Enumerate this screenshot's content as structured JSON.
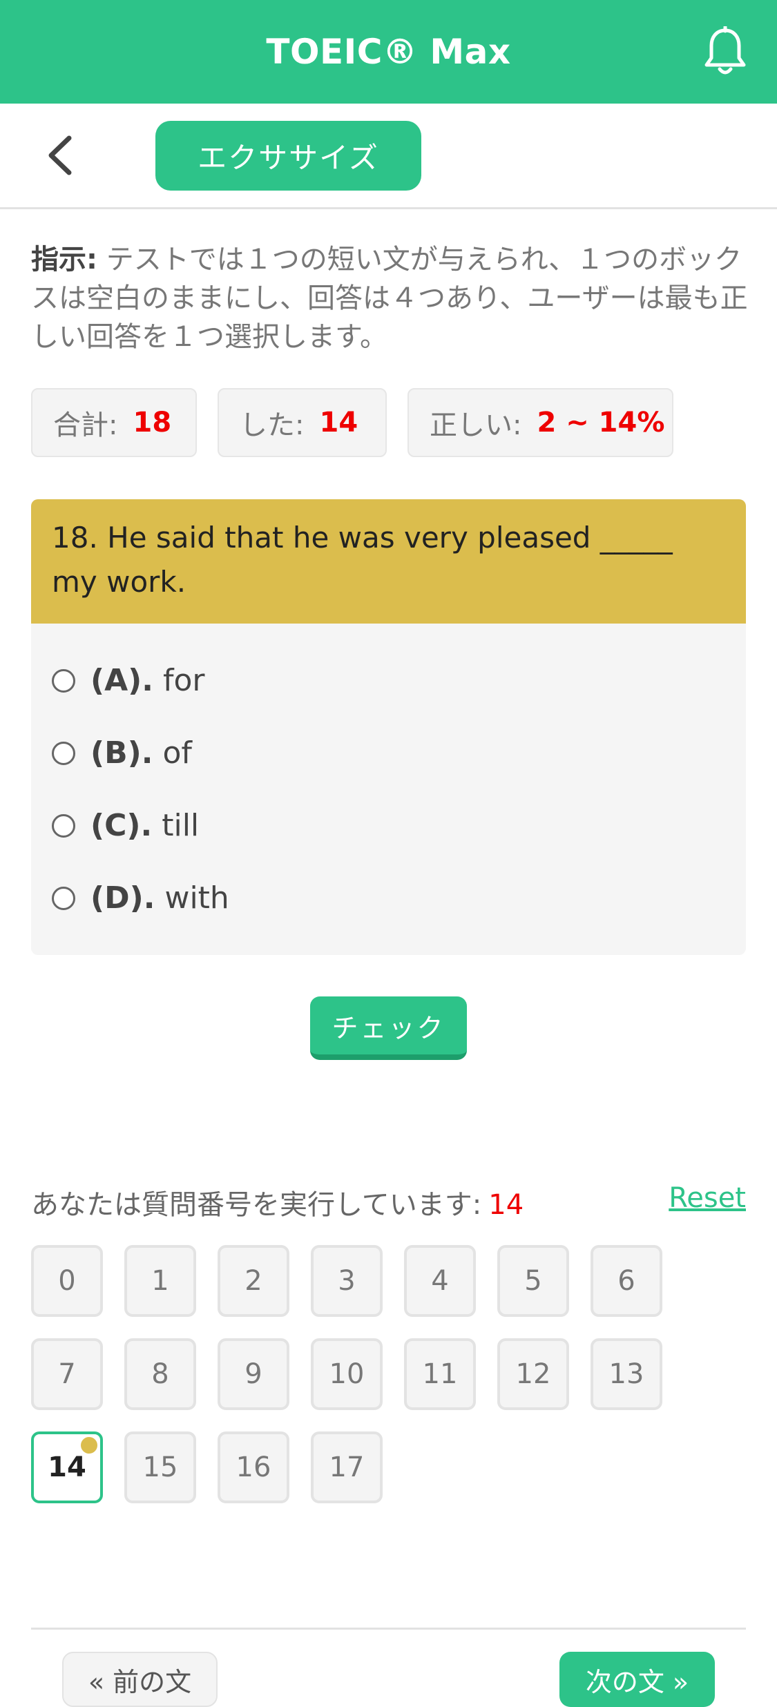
{
  "header": {
    "title": "TOEIC® Max",
    "bell_icon": "bell-icon",
    "bg_color": "#2dc389"
  },
  "subbar": {
    "back_icon": "chevron-left-icon",
    "tab_label": "エクササイズ"
  },
  "instructions": {
    "label": "指示:",
    "text": " テストでは１つの短い文が与えられ、１つのボックスは空白のままにし、回答は４つあり、ユーザーは最も正しい回答を１つ選択します。"
  },
  "stats": {
    "total_label": "合計:",
    "total_value": "18",
    "done_label": "した:",
    "done_value": "14",
    "correct_label": "正しい:",
    "correct_value": "2 ~ 14%"
  },
  "question": {
    "text": "18. He said that he was very pleased _____ my work.",
    "options": [
      {
        "key": "(A).",
        "text": "for"
      },
      {
        "key": "(B).",
        "text": "of"
      },
      {
        "key": "(C).",
        "text": "till"
      },
      {
        "key": "(D).",
        "text": "with"
      }
    ]
  },
  "check_label": "チェック",
  "progress": {
    "label": "あなたは質問番号を実行しています:",
    "current": "14",
    "reset_label": "Reset"
  },
  "grid": [
    "0",
    "1",
    "2",
    "3",
    "4",
    "5",
    "6",
    "7",
    "8",
    "9",
    "10",
    "11",
    "12",
    "13",
    "14",
    "15",
    "16",
    "17"
  ],
  "current_index": 14,
  "nav": {
    "prev_label": "« 前の文",
    "next_label": "次の文 »"
  }
}
